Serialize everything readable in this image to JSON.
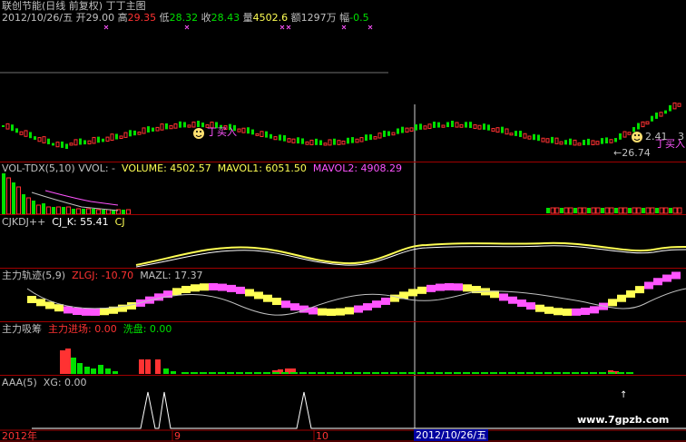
{
  "colors": {
    "background": "#000000",
    "rise": "#ff3232",
    "fall": "#00e000",
    "yellow": "#ffff54",
    "magenta": "#ff54ff",
    "white": "#ffffff",
    "cyan": "#54ffff",
    "divider": "#a00000"
  },
  "header": {
    "title": "联创节能(日线 前复权) 丁丁主图",
    "date": "2012/10/26/五",
    "open_label": "开",
    "open": "29.00",
    "high_label": "高",
    "high": "29.35",
    "low_label": "低",
    "low": "28.32",
    "close_label": "收",
    "close": "28.43",
    "volume_label": "量",
    "volume": "4502.6",
    "amount_label": "额",
    "amount": "1297万",
    "change_label": "幅",
    "change": "-0.5"
  },
  "main_chart": {
    "buy_label": "丁买入",
    "buy_label_2": "丁买入",
    "price_low": "←26.74",
    "price_high": "2.41",
    "price_high_2": "3"
  },
  "vol_panel": {
    "title": "VOL-TDX(5,10)",
    "vvol": "VVOL: -",
    "volume": "VOLUME: 4502.57",
    "mavol1": "MAVOL1: 6051.50",
    "mavol2": "MAVOL2: 4908.29"
  },
  "cjkdj_panel": {
    "title": "CJKDJ++",
    "cjk": "CJ_K: 55.41",
    "cj": "CJ"
  },
  "zlgj_panel": {
    "title": "主力轨迹(5,9)",
    "zlgj": "ZLGJ: -10.70",
    "mazl": "MAZL: 17.37"
  },
  "zlxc_panel": {
    "title": "主力吸筹",
    "enter": "主力进场: 0.00",
    "wash": "洗盘: 0.00"
  },
  "aaa_panel": {
    "title": "AAA(5)",
    "xg": "XG: 0.00"
  },
  "x_axis": {
    "labels": [
      "2012年",
      "9",
      "10"
    ],
    "current": "2012/10/26/五"
  },
  "watermark": "www.7gpzb.com"
}
